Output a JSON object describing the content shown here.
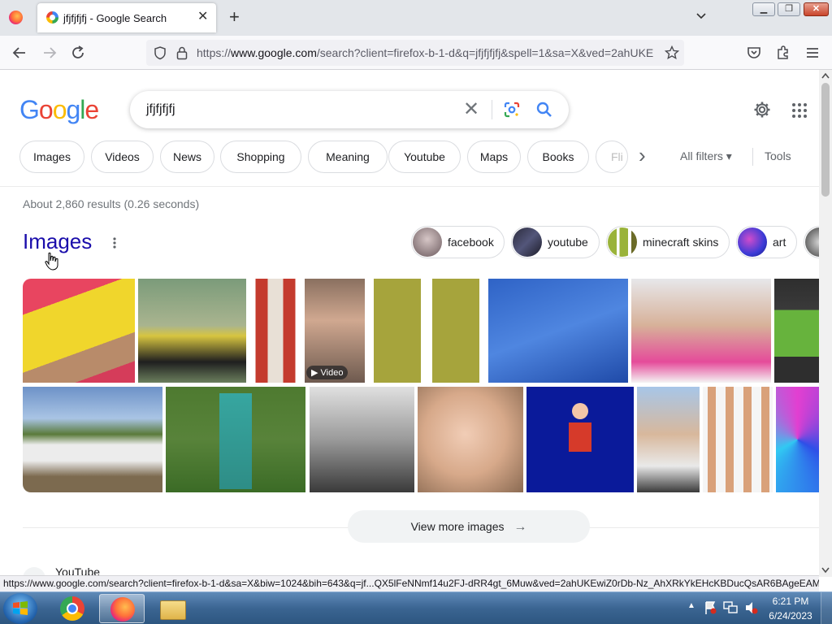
{
  "browser": {
    "tab_title": "jfjfjfjfj - Google Search",
    "tab_close": "✕",
    "new_tab": "+",
    "url_prefix": "https://",
    "url_host": "www.google.com",
    "url_rest": "/search?client=firefox-b-1-d&q=jfjfjfjfj&spell=1&sa=X&ved=2ahUKE",
    "window_buttons": {
      "minimize": "▁",
      "maximize": "❐",
      "close": "✕"
    },
    "status_url": "https://www.google.com/search?client=firefox-b-1-d&sa=X&biw=1024&bih=643&q=jf...QX5lFeNNmf14u2FJ-dRR4gt_6Muw&ved=2ahUKEwiZ0rDb-Nz_AhXRkYkEHcKBDucQsAR6BAgeEAM"
  },
  "search": {
    "logo_letters": [
      "G",
      "o",
      "o",
      "g",
      "l",
      "e"
    ],
    "logo_colors": [
      "#4285f4",
      "#ea4335",
      "#fbbc05",
      "#4285f4",
      "#34a853",
      "#ea4335"
    ],
    "query": "jfjfjfjfj",
    "clear_symbol": "✕"
  },
  "filter_chips": [
    "Images",
    "Videos",
    "News",
    "Shopping",
    "Meaning",
    "Youtube",
    "Maps",
    "Books",
    "Fli"
  ],
  "all_filters": "All filters ▾",
  "tools": "Tools",
  "more_chips_arrow": "›",
  "results": {
    "stats": "About 2,860 results (0.26 seconds)",
    "images_heading": "Images",
    "image_suggestions": [
      "facebook",
      "youtube",
      "minecraft skins",
      "art"
    ],
    "video_badge": "▶ Video",
    "view_more": "View more images",
    "view_more_arrow": "→",
    "next_result_source": "YouTube"
  },
  "taskbar": {
    "time": "6:21 PM",
    "date": "6/24/2023"
  },
  "colors": {
    "link_blue": "#1a0dab",
    "accent_blue": "#4285f4"
  }
}
